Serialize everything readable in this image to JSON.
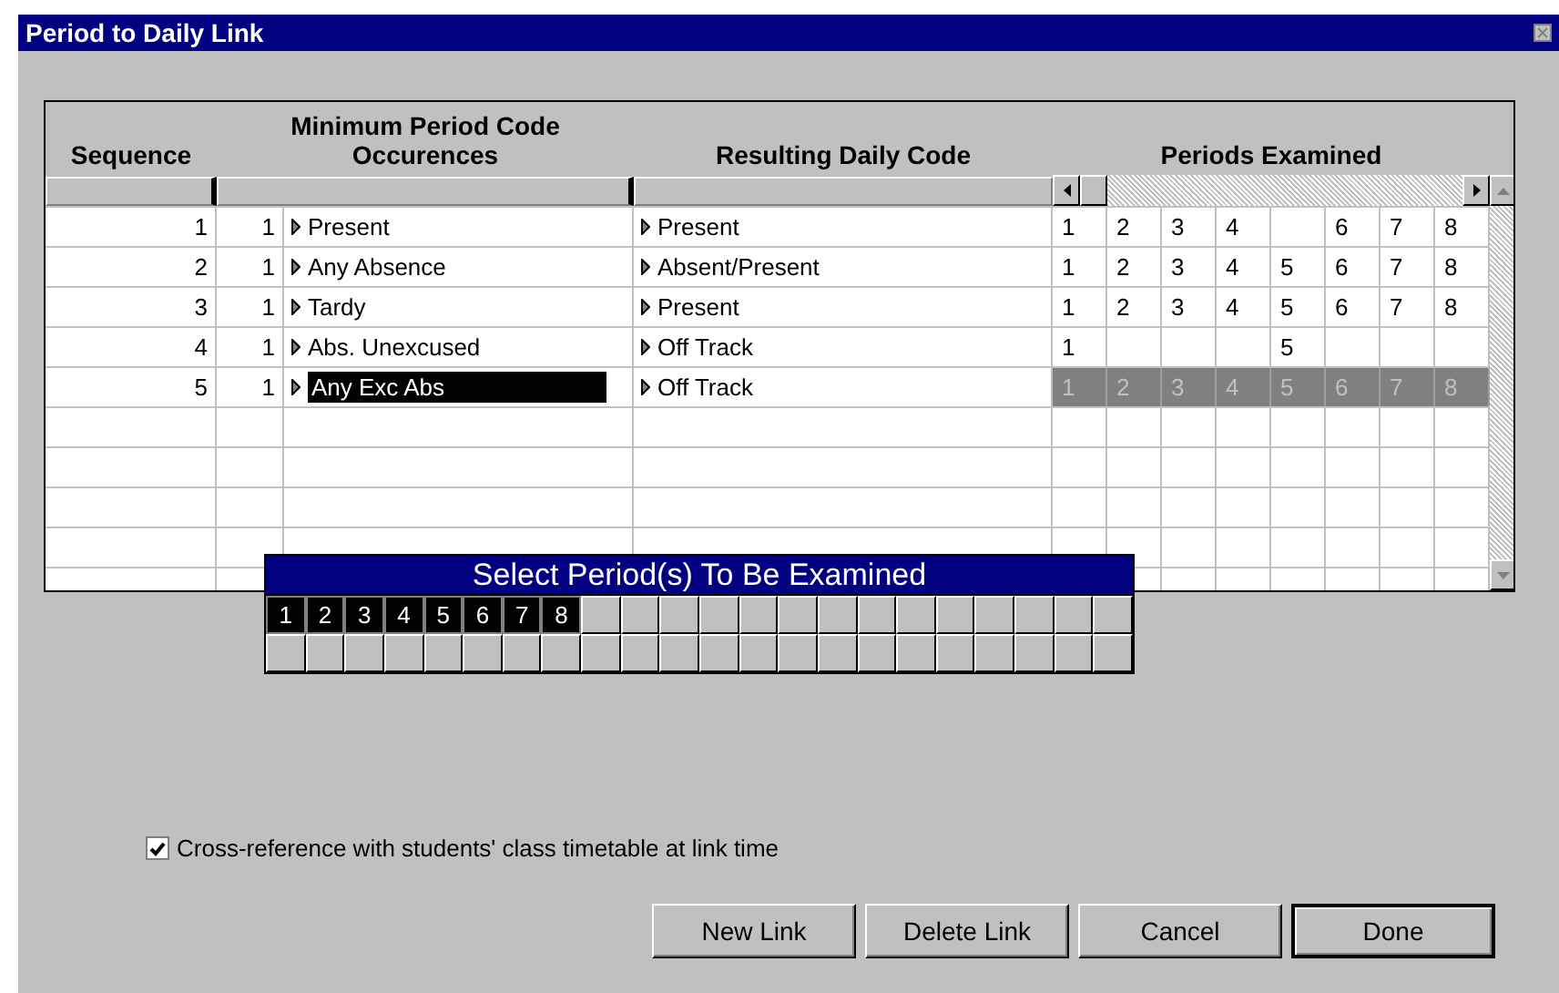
{
  "window": {
    "title": "Period to Daily Link"
  },
  "table": {
    "columns": [
      "Sequence",
      "Minimum Period Code Occurences",
      "Resulting Daily Code",
      "Periods Examined"
    ],
    "rows": [
      {
        "sequence": "1",
        "count": "1",
        "code": "Present",
        "daily_code": "Present",
        "selected": false,
        "periods": [
          {
            "examined": true,
            "label": "1"
          },
          {
            "examined": true,
            "label": "2"
          },
          {
            "examined": true,
            "label": "3"
          },
          {
            "examined": true,
            "label": "4"
          },
          {
            "examined": false
          },
          {
            "examined": true,
            "label": "6"
          },
          {
            "examined": true,
            "label": "7"
          },
          {
            "examined": true,
            "label": "8"
          }
        ]
      },
      {
        "sequence": "2",
        "count": "1",
        "code": "Any Absence",
        "daily_code": "Absent/Present",
        "selected": false,
        "periods": [
          {
            "examined": true,
            "label": "1"
          },
          {
            "examined": true,
            "label": "2"
          },
          {
            "examined": true,
            "label": "3"
          },
          {
            "examined": true,
            "label": "4"
          },
          {
            "examined": true,
            "label": "5"
          },
          {
            "examined": true,
            "label": "6"
          },
          {
            "examined": true,
            "label": "7"
          },
          {
            "examined": true,
            "label": "8"
          }
        ]
      },
      {
        "sequence": "3",
        "count": "1",
        "code": "Tardy",
        "daily_code": "Present",
        "selected": false,
        "periods": [
          {
            "examined": true,
            "label": "1"
          },
          {
            "examined": true,
            "label": "2"
          },
          {
            "examined": true,
            "label": "3"
          },
          {
            "examined": true,
            "label": "4"
          },
          {
            "examined": true,
            "label": "5"
          },
          {
            "examined": true,
            "label": "6"
          },
          {
            "examined": true,
            "label": "7"
          },
          {
            "examined": true,
            "label": "8"
          }
        ]
      },
      {
        "sequence": "4",
        "count": "1",
        "code": "Abs. Unexcused",
        "daily_code": "Off Track",
        "selected": false,
        "periods": [
          {
            "examined": true,
            "label": "1"
          },
          {
            "examined": false
          },
          {
            "examined": false
          },
          {
            "examined": false
          },
          {
            "examined": true,
            "label": "5"
          },
          {
            "examined": false
          },
          {
            "examined": false
          },
          {
            "examined": false
          }
        ]
      },
      {
        "sequence": "5",
        "count": "1",
        "code": "Any Exc Abs",
        "daily_code": "Off Track",
        "selected": true,
        "periods": [
          {
            "examined": true,
            "label": "1"
          },
          {
            "examined": true,
            "label": "2"
          },
          {
            "examined": true,
            "label": "3"
          },
          {
            "examined": true,
            "label": "4"
          },
          {
            "examined": true,
            "label": "5"
          },
          {
            "examined": true,
            "label": "6"
          },
          {
            "examined": true,
            "label": "7"
          },
          {
            "examined": true,
            "label": "8"
          }
        ]
      }
    ]
  },
  "period_picker": {
    "title": "Select Period(s) To Be Examined",
    "periods": [
      {
        "label": "1",
        "selected": true
      },
      {
        "label": "2",
        "selected": true
      },
      {
        "label": "3",
        "selected": true
      },
      {
        "label": "4",
        "selected": true
      },
      {
        "label": "5",
        "selected": true
      },
      {
        "label": "6",
        "selected": true
      },
      {
        "label": "7",
        "selected": true
      },
      {
        "label": "8",
        "selected": true
      }
    ]
  },
  "cross_reference": {
    "label": "Cross-reference with students' class timetable at link time",
    "checked": true
  },
  "buttons": [
    {
      "label": "New Link",
      "default": false
    },
    {
      "label": "Delete Link",
      "default": false
    },
    {
      "label": "Cancel",
      "default": false
    },
    {
      "label": "Done",
      "default": true
    }
  ]
}
